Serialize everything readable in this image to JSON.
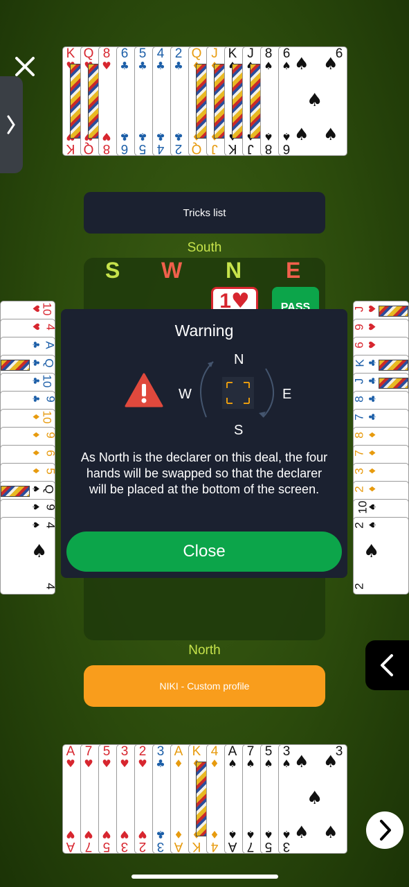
{
  "top_hand": {
    "cards": [
      {
        "rank": "K",
        "suit": "♥",
        "color": "red",
        "face": true
      },
      {
        "rank": "Q",
        "suit": "♥",
        "color": "red",
        "face": true
      },
      {
        "rank": "8",
        "suit": "♥",
        "color": "red"
      },
      {
        "rank": "6",
        "suit": "♣",
        "color": "blu"
      },
      {
        "rank": "5",
        "suit": "♣",
        "color": "blu"
      },
      {
        "rank": "4",
        "suit": "♣",
        "color": "blu"
      },
      {
        "rank": "2",
        "suit": "♣",
        "color": "blu"
      },
      {
        "rank": "Q",
        "suit": "♦",
        "color": "yel",
        "face": true
      },
      {
        "rank": "J",
        "suit": "♦",
        "color": "yel",
        "face": true
      },
      {
        "rank": "K",
        "suit": "♠",
        "color": "blk",
        "face": true
      },
      {
        "rank": "J",
        "suit": "♠",
        "color": "blk",
        "face": true
      },
      {
        "rank": "8",
        "suit": "♠",
        "color": "blk"
      },
      {
        "rank": "6",
        "suit": "♠",
        "color": "blk"
      }
    ]
  },
  "bottom_hand": {
    "cards": [
      {
        "rank": "A",
        "suit": "♥",
        "color": "red"
      },
      {
        "rank": "7",
        "suit": "♥",
        "color": "red"
      },
      {
        "rank": "5",
        "suit": "♥",
        "color": "red"
      },
      {
        "rank": "3",
        "suit": "♥",
        "color": "red"
      },
      {
        "rank": "2",
        "suit": "♥",
        "color": "red"
      },
      {
        "rank": "3",
        "suit": "♣",
        "color": "blu"
      },
      {
        "rank": "A",
        "suit": "♦",
        "color": "yel"
      },
      {
        "rank": "K",
        "suit": "♦",
        "color": "yel",
        "face": true
      },
      {
        "rank": "4",
        "suit": "♦",
        "color": "yel"
      },
      {
        "rank": "A",
        "suit": "♠",
        "color": "blk"
      },
      {
        "rank": "7",
        "suit": "♠",
        "color": "blk"
      },
      {
        "rank": "5",
        "suit": "♠",
        "color": "blk"
      },
      {
        "rank": "3",
        "suit": "♠",
        "color": "blk"
      }
    ]
  },
  "left_hand": {
    "cards": [
      {
        "rank": "10",
        "suit": "♥",
        "color": "red"
      },
      {
        "rank": "4",
        "suit": "♥",
        "color": "red"
      },
      {
        "rank": "A",
        "suit": "♣",
        "color": "blu"
      },
      {
        "rank": "Q",
        "suit": "♣",
        "color": "blu",
        "face": true
      },
      {
        "rank": "10",
        "suit": "♣",
        "color": "blu"
      },
      {
        "rank": "9",
        "suit": "♣",
        "color": "blu"
      },
      {
        "rank": "10",
        "suit": "♦",
        "color": "yel"
      },
      {
        "rank": "9",
        "suit": "♦",
        "color": "yel"
      },
      {
        "rank": "6",
        "suit": "♦",
        "color": "yel"
      },
      {
        "rank": "5",
        "suit": "♦",
        "color": "yel"
      },
      {
        "rank": "Q",
        "suit": "♠",
        "color": "blk",
        "face": true
      },
      {
        "rank": "9",
        "suit": "♠",
        "color": "blk"
      },
      {
        "rank": "4",
        "suit": "♠",
        "color": "blk"
      }
    ]
  },
  "right_hand": {
    "cards": [
      {
        "rank": "J",
        "suit": "♥",
        "color": "red",
        "face": true
      },
      {
        "rank": "9",
        "suit": "♥",
        "color": "red"
      },
      {
        "rank": "6",
        "suit": "♥",
        "color": "red"
      },
      {
        "rank": "K",
        "suit": "♣",
        "color": "blu",
        "face": true
      },
      {
        "rank": "J",
        "suit": "♣",
        "color": "blu",
        "face": true
      },
      {
        "rank": "8",
        "suit": "♣",
        "color": "blu"
      },
      {
        "rank": "7",
        "suit": "♣",
        "color": "blu"
      },
      {
        "rank": "8",
        "suit": "♦",
        "color": "yel"
      },
      {
        "rank": "7",
        "suit": "♦",
        "color": "yel"
      },
      {
        "rank": "3",
        "suit": "♦",
        "color": "yel"
      },
      {
        "rank": "2",
        "suit": "♦",
        "color": "yel"
      },
      {
        "rank": "10",
        "suit": "♠",
        "color": "blk"
      },
      {
        "rank": "2",
        "suit": "♠",
        "color": "blk"
      }
    ]
  },
  "tricks_button": {
    "label": "Tricks list"
  },
  "seat_top": "South",
  "seat_bottom": "North",
  "bidding": {
    "columns": [
      {
        "label": "S",
        "color": "#c6e34b"
      },
      {
        "label": "W",
        "color": "#f0604c"
      },
      {
        "label": "N",
        "color": "#c6e34b"
      },
      {
        "label": "E",
        "color": "#f0604c"
      }
    ],
    "bids": [
      {
        "level": "1",
        "suit": "♥"
      },
      {
        "text": "PASS"
      }
    ]
  },
  "profile_button": {
    "label": "NIKI - Custom profile"
  },
  "warning": {
    "title": "Warning",
    "compass": {
      "n": "N",
      "s": "S",
      "w": "W",
      "e": "E"
    },
    "message": "As North is the declarer on this deal, the four hands will be swapped so that the declarer will be placed at the bottom of the screen.",
    "close_label": "Close"
  },
  "colors": {
    "felt": "#2f4f0d",
    "panel_dark": "#1b2130",
    "accent_green": "#0ca54a",
    "accent_orange": "#f99d1c",
    "seat_label": "#c6e34b"
  },
  "icons": {
    "close": "close-icon",
    "sidebar_toggle": "chevron-right-icon",
    "drawer_open": "chevron-left-icon",
    "next": "chevron-right-icon",
    "warning": "warning-triangle-icon"
  }
}
